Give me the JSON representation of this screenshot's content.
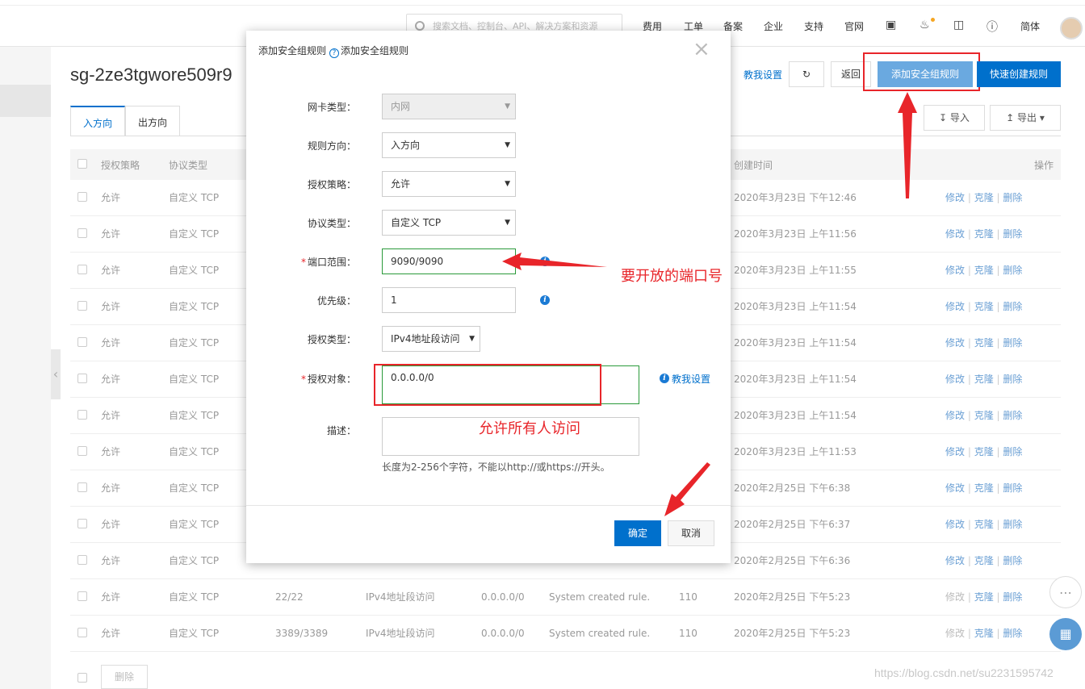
{
  "header": {
    "search_placeholder": "搜索文档、控制台、API、解决方案和资源",
    "nav": [
      "费用",
      "工单",
      "备案",
      "企业",
      "支持",
      "官网"
    ],
    "lang": "简体",
    "icons": [
      "terminal-icon",
      "bell-icon",
      "cart-icon",
      "help-icon"
    ]
  },
  "page": {
    "title": "sg-2ze3tgwore509r9",
    "help_link": "教我设置",
    "back_label": "返回",
    "add_rule_label": "添加安全组规则",
    "quick_create_label": "快速创建规则",
    "import_label": "导入",
    "export_label": "导出",
    "tabs": [
      "入方向",
      "出方向"
    ],
    "delete_label": "删除",
    "watermark": "https://blog.csdn.net/su2231595742"
  },
  "table": {
    "headers": {
      "policy": "授权策略",
      "protocol": "协议类型",
      "created": "创建时间",
      "ops": "操作"
    },
    "actions": {
      "edit": "修改",
      "clone": "克隆",
      "delete": "删除"
    },
    "rows": [
      {
        "policy": "允许",
        "protocol": "自定义 TCP",
        "port": "",
        "auth_type": "",
        "object": "",
        "desc": "",
        "priority": "",
        "created": "2020年3月23日 下午12:46",
        "edit_disabled": false
      },
      {
        "policy": "允许",
        "protocol": "自定义 TCP",
        "port": "",
        "auth_type": "",
        "object": "",
        "desc": "",
        "priority": "",
        "created": "2020年3月23日 上午11:56",
        "edit_disabled": false
      },
      {
        "policy": "允许",
        "protocol": "自定义 TCP",
        "port": "",
        "auth_type": "",
        "object": "",
        "desc": "",
        "priority": "",
        "created": "2020年3月23日 上午11:55",
        "edit_disabled": false
      },
      {
        "policy": "允许",
        "protocol": "自定义 TCP",
        "port": "",
        "auth_type": "",
        "object": "",
        "desc": "",
        "priority": "",
        "created": "2020年3月23日 上午11:54",
        "edit_disabled": false
      },
      {
        "policy": "允许",
        "protocol": "自定义 TCP",
        "port": "",
        "auth_type": "",
        "object": "",
        "desc": "",
        "priority": "",
        "created": "2020年3月23日 上午11:54",
        "edit_disabled": false
      },
      {
        "policy": "允许",
        "protocol": "自定义 TCP",
        "port": "",
        "auth_type": "",
        "object": "",
        "desc": "",
        "priority": "",
        "created": "2020年3月23日 上午11:54",
        "edit_disabled": false
      },
      {
        "policy": "允许",
        "protocol": "自定义 TCP",
        "port": "",
        "auth_type": "",
        "object": "",
        "desc": "",
        "priority": "",
        "created": "2020年3月23日 上午11:54",
        "edit_disabled": false
      },
      {
        "policy": "允许",
        "protocol": "自定义 TCP",
        "port": "",
        "auth_type": "",
        "object": "",
        "desc": "",
        "priority": "",
        "created": "2020年3月23日 上午11:53",
        "edit_disabled": false
      },
      {
        "policy": "允许",
        "protocol": "自定义 TCP",
        "port": "",
        "auth_type": "",
        "object": "",
        "desc": "",
        "priority": "",
        "created": "2020年2月25日 下午6:38",
        "edit_disabled": false
      },
      {
        "policy": "允许",
        "protocol": "自定义 TCP",
        "port": "",
        "auth_type": "",
        "object": "",
        "desc": "",
        "priority": "",
        "created": "2020年2月25日 下午6:37",
        "edit_disabled": false
      },
      {
        "policy": "允许",
        "protocol": "自定义 TCP",
        "port": "",
        "auth_type": "",
        "object": "",
        "desc": "",
        "priority": "",
        "created": "2020年2月25日 下午6:36",
        "edit_disabled": false
      },
      {
        "policy": "允许",
        "protocol": "自定义 TCP",
        "port": "22/22",
        "auth_type": "IPv4地址段访问",
        "object": "0.0.0.0/0",
        "desc": "System created rule.",
        "priority": "110",
        "created": "2020年2月25日 下午5:23",
        "edit_disabled": true
      },
      {
        "policy": "允许",
        "protocol": "自定义 TCP",
        "port": "3389/3389",
        "auth_type": "IPv4地址段访问",
        "object": "0.0.0.0/0",
        "desc": "System created rule.",
        "priority": "110",
        "created": "2020年2月25日 下午5:23",
        "edit_disabled": true
      }
    ]
  },
  "modal": {
    "title": "添加安全组规则",
    "title_help": "添加安全组规则",
    "fields": {
      "nic_type": {
        "label": "网卡类型：",
        "value": "内网"
      },
      "direction": {
        "label": "规则方向：",
        "value": "入方向"
      },
      "policy": {
        "label": "授权策略：",
        "value": "允许"
      },
      "protocol": {
        "label": "协议类型：",
        "value": "自定义 TCP"
      },
      "port_range": {
        "label": "端口范围：",
        "value": "9090/9090"
      },
      "priority": {
        "label": "优先级：",
        "value": "1"
      },
      "auth_type": {
        "label": "授权类型：",
        "value": "IPv4地址段访问"
      },
      "auth_object": {
        "label": "授权对象：",
        "value": "0.0.0.0/0",
        "help": "教我设置"
      },
      "description": {
        "label": "描述：",
        "value": "",
        "hint": "长度为2-256个字符，不能以http://或https://开头。"
      }
    },
    "ok_label": "确定",
    "cancel_label": "取消"
  },
  "annotations": {
    "port_note": "要开放的端口号",
    "access_note": "允许所有人访问"
  },
  "colors": {
    "accent": "#0070cc",
    "annotation": "#e8252a",
    "valid": "#2a9a3a"
  }
}
